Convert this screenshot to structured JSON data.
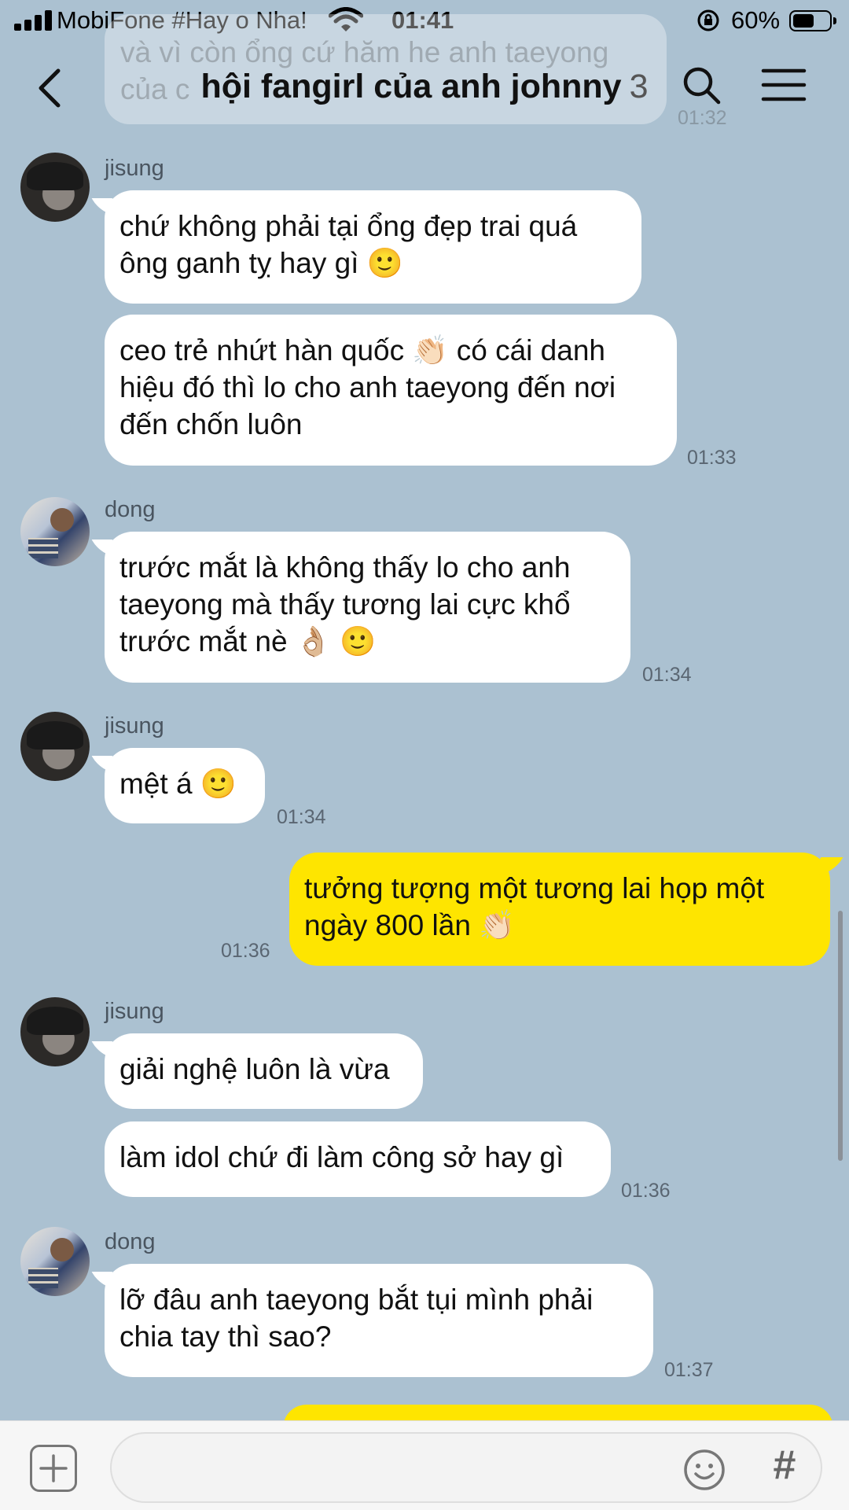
{
  "status_bar": {
    "carrier": "MobiFone #Hay o Nha!",
    "time": "01:41",
    "battery_percent": "60%",
    "battery_level": 0.6
  },
  "header": {
    "title": "hội fangirl của anh johnny",
    "member_count": "3"
  },
  "faded_previous": {
    "text": "và vì còn ổng cứ hăm he anh taeyong\ncủa c",
    "time": "01:32"
  },
  "messages": [
    {
      "sender": "jisung",
      "text": "chứ không phải tại ổng đẹp trai quá\nông ganh tỵ hay gì 🙂"
    },
    {
      "text": "ceo trẻ nhứt hàn quốc 👏🏻 có cái danh\nhiệu đó thì lo cho anh taeyong đến nơi\nđến chốn luôn",
      "time": "01:33"
    },
    {
      "sender": "dong",
      "text": "trước mắt là không thấy lo cho anh\ntaeyong mà thấy tương lai cực khổ\ntrước mắt nè 👌🏼 🙂",
      "time": "01:34"
    },
    {
      "sender": "jisung",
      "text": "mệt á 🙂",
      "time": "01:34"
    },
    {
      "mine": true,
      "text": "tưởng tượng một tương lai họp một\nngày 800 lần 👏🏻",
      "time": "01:36"
    },
    {
      "sender": "jisung",
      "text": "giải nghệ luôn là vừa"
    },
    {
      "text": "làm idol chứ đi làm công sở hay gì",
      "time": "01:36"
    },
    {
      "sender": "dong",
      "text": "lỡ đâu anh taeyong bắt tụi mình phải\nchia tay thì sao?",
      "time": "01:37"
    }
  ],
  "input": {
    "value": "",
    "placeholder": ""
  },
  "icons": {
    "back": "back-arrow-icon",
    "search": "search-icon",
    "menu": "hamburger-menu-icon",
    "plus": "plus-icon",
    "emoji": "emoji-icon",
    "hash": "#"
  },
  "colors": {
    "background": "#abc1d1",
    "my_bubble": "#fee500",
    "other_bubble": "#ffffff"
  }
}
